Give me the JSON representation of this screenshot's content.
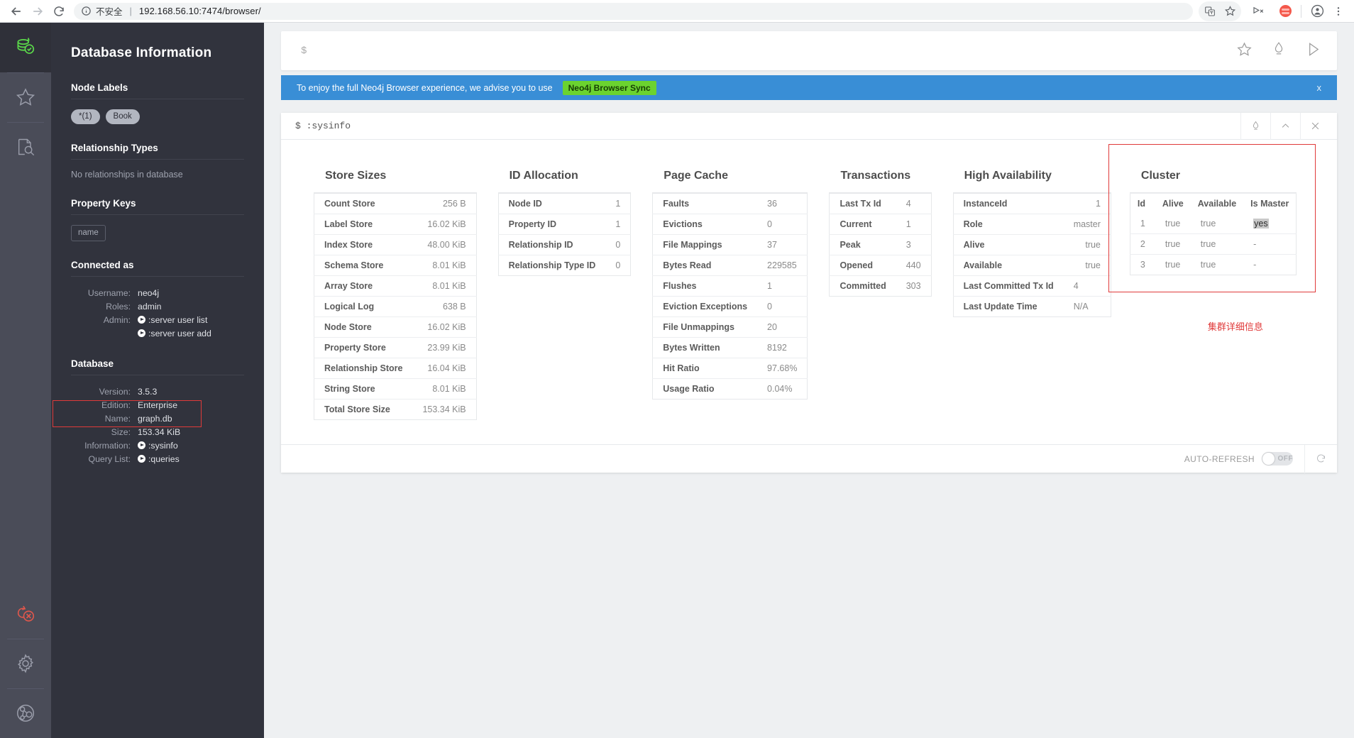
{
  "browser": {
    "security_label": "不安全",
    "url": "192.168.56.10:7474/browser/",
    "back_icon": "back-arrow-icon",
    "forward_icon": "forward-arrow-icon",
    "reload_icon": "reload-icon",
    "info_icon": "info-circle-icon",
    "translate_icon": "translate-icon",
    "bookmark_icon": "star-icon",
    "cast_icon": "cast-icon",
    "profile_icon": "profile-avatar-icon",
    "menu_icon": "three-dot-menu-icon"
  },
  "rail": {
    "items": [
      {
        "name": "database-check-icon",
        "active": true
      },
      {
        "name": "favorites-star-icon",
        "active": false
      },
      {
        "name": "documents-search-icon",
        "active": false
      },
      {
        "name": "disconnect-icon",
        "active": false
      },
      {
        "name": "settings-gear-icon",
        "active": false
      },
      {
        "name": "about-graph-icon",
        "active": false
      }
    ]
  },
  "sidebar": {
    "title": "Database Information",
    "node_labels": {
      "heading": "Node Labels",
      "chips": [
        "*(1)",
        "Book"
      ]
    },
    "relationship_types": {
      "heading": "Relationship Types",
      "empty_text": "No relationships in database"
    },
    "property_keys": {
      "heading": "Property Keys",
      "chips": [
        "name"
      ]
    },
    "connected_as": {
      "heading": "Connected as",
      "rows": [
        {
          "key": "Username:",
          "value": "neo4j",
          "cmd": false
        },
        {
          "key": "Roles:",
          "value": "admin",
          "cmd": false
        },
        {
          "key": "Admin:",
          "value": ":server user list",
          "cmd": true
        },
        {
          "key": "",
          "value": ":server user add",
          "cmd": true
        }
      ]
    },
    "database": {
      "heading": "Database",
      "rows": [
        {
          "key": "Version:",
          "value": "3.5.3",
          "cmd": false
        },
        {
          "key": "Edition:",
          "value": "Enterprise",
          "cmd": false
        },
        {
          "key": "Name:",
          "value": "graph.db",
          "cmd": false
        },
        {
          "key": "Size:",
          "value": "153.34 KiB",
          "cmd": false
        },
        {
          "key": "Information:",
          "value": ":sysinfo",
          "cmd": true
        },
        {
          "key": "Query List:",
          "value": ":queries",
          "cmd": true
        }
      ]
    }
  },
  "editor": {
    "prompt": "$",
    "placeholder": "",
    "icons": [
      "favorite-star-icon",
      "clear-editor-icon",
      "run-query-icon"
    ]
  },
  "banner": {
    "text": "To enjoy the full Neo4j Browser experience, we advise you to use",
    "cta": "Neo4j Browser Sync",
    "close": "x"
  },
  "frame": {
    "command": "$ :sysinfo",
    "tools": [
      "pin-icon",
      "collapse-chevron-up-icon",
      "close-x-icon"
    ],
    "footer": {
      "auto_refresh_label": "AUTO-REFRESH",
      "toggle_state": "OFF",
      "refresh_icon": "refresh-spinner-icon"
    }
  },
  "tables": [
    {
      "title": "Store Sizes",
      "align": "right",
      "rows": [
        [
          "Count Store",
          "256 B"
        ],
        [
          "Label Store",
          "16.02 KiB"
        ],
        [
          "Index Store",
          "48.00 KiB"
        ],
        [
          "Schema Store",
          "8.01 KiB"
        ],
        [
          "Array Store",
          "8.01 KiB"
        ],
        [
          "Logical Log",
          "638 B"
        ],
        [
          "Node Store",
          "16.02 KiB"
        ],
        [
          "Property Store",
          "23.99 KiB"
        ],
        [
          "Relationship Store",
          "16.04 KiB"
        ],
        [
          "String Store",
          "8.01 KiB"
        ],
        [
          "Total Store Size",
          "153.34 KiB"
        ]
      ]
    },
    {
      "title": "ID Allocation",
      "align": "right",
      "rows": [
        [
          "Node ID",
          "1"
        ],
        [
          "Property ID",
          "1"
        ],
        [
          "Relationship ID",
          "0"
        ],
        [
          "Relationship Type ID",
          "0"
        ]
      ]
    },
    {
      "title": "Page Cache",
      "align": "left",
      "rows": [
        [
          "Faults",
          "36"
        ],
        [
          "Evictions",
          "0"
        ],
        [
          "File Mappings",
          "37"
        ],
        [
          "Bytes Read",
          "229585"
        ],
        [
          "Flushes",
          "1"
        ],
        [
          "Eviction Exceptions",
          "0"
        ],
        [
          "File Unmappings",
          "20"
        ],
        [
          "Bytes Written",
          "8192"
        ],
        [
          "Hit Ratio",
          "97.68%"
        ],
        [
          "Usage Ratio",
          "0.04%"
        ]
      ]
    },
    {
      "title": "Transactions",
      "align": "left",
      "rows": [
        [
          "Last Tx Id",
          "4"
        ],
        [
          "Current",
          "1"
        ],
        [
          "Peak",
          "3"
        ],
        [
          "Opened",
          "440"
        ],
        [
          "Committed",
          "303"
        ]
      ]
    },
    {
      "title": "High Availability",
      "align": "right",
      "rows": [
        [
          "InstanceId",
          "1"
        ],
        [
          "Role",
          "master"
        ],
        [
          "Alive",
          "true"
        ],
        [
          "Available",
          "true"
        ],
        [
          "Last Committed Tx Id",
          "4"
        ],
        [
          "Last Update Time",
          "N/A"
        ]
      ]
    }
  ],
  "cluster": {
    "title": "Cluster",
    "columns": [
      "Id",
      "Alive",
      "Available",
      "Is Master"
    ],
    "rows": [
      [
        "1",
        "true",
        "true",
        "yes"
      ],
      [
        "2",
        "true",
        "true",
        "-"
      ],
      [
        "3",
        "true",
        "true",
        "-"
      ]
    ],
    "selected_cell": "yes"
  },
  "annotations": {
    "cluster_note": "集群详细信息",
    "highlight_color": "#e03a3a"
  }
}
